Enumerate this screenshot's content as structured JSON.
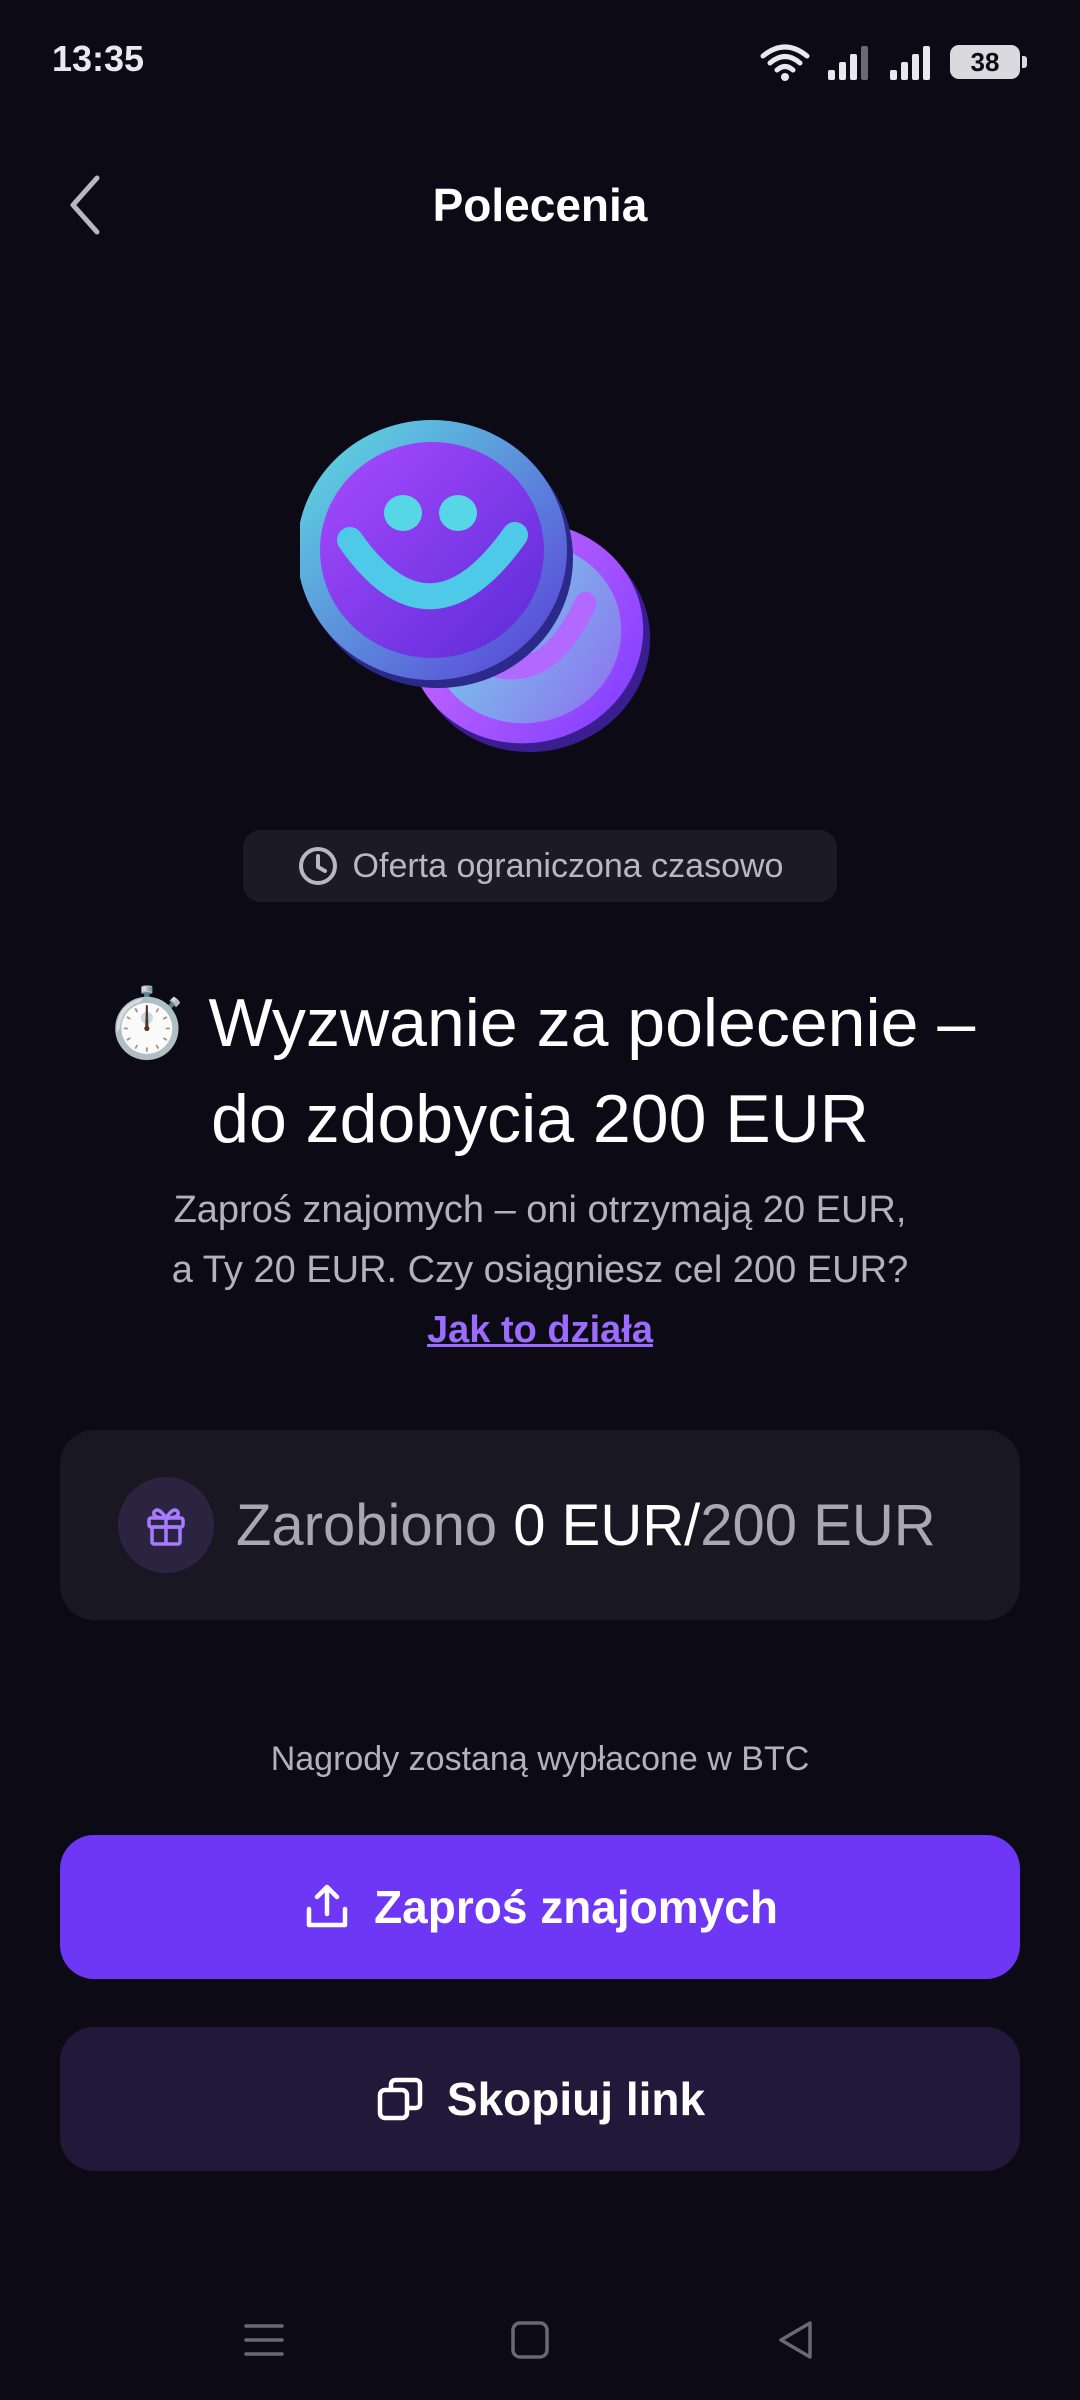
{
  "status_bar": {
    "time": "13:35",
    "battery": "38",
    "icons": [
      "wifi-icon",
      "signal-icon",
      "signal-icon",
      "battery-icon"
    ]
  },
  "header": {
    "title": "Polecenia",
    "back_icon": "chevron-left-icon"
  },
  "hero": {
    "image": "smiley-coins-illustration"
  },
  "chip": {
    "label": "Oferta ograniczona czasowo",
    "icon": "clock-icon"
  },
  "headline": {
    "emoji": "⏱️",
    "line1": "Wyzwanie za polecenie –",
    "line2": "do zdobycia 200 EUR"
  },
  "subtitle": {
    "line1": "Zaproś znajomych – oni otrzymają 20 EUR,",
    "line2": "a Ty 20 EUR. Czy osiągniesz cel 200 EUR?",
    "link": "Jak to działa"
  },
  "progress": {
    "label": "Zarobiono",
    "earned": "0 EUR/",
    "goal": "200 EUR",
    "icon": "gift-icon"
  },
  "payout_note": "Nagrody zostaną wypłacone w BTC",
  "buttons": {
    "invite": "Zaproś znajomych",
    "invite_icon": "share-icon",
    "copy": "Skopiuj link",
    "copy_icon": "copy-icon"
  },
  "nav": [
    "menu-icon",
    "home-icon",
    "back-icon"
  ],
  "colors": {
    "background": "#0c0a15",
    "accent": "#6e36f5",
    "link": "#9b6cff",
    "secondary_button": "#221839"
  }
}
